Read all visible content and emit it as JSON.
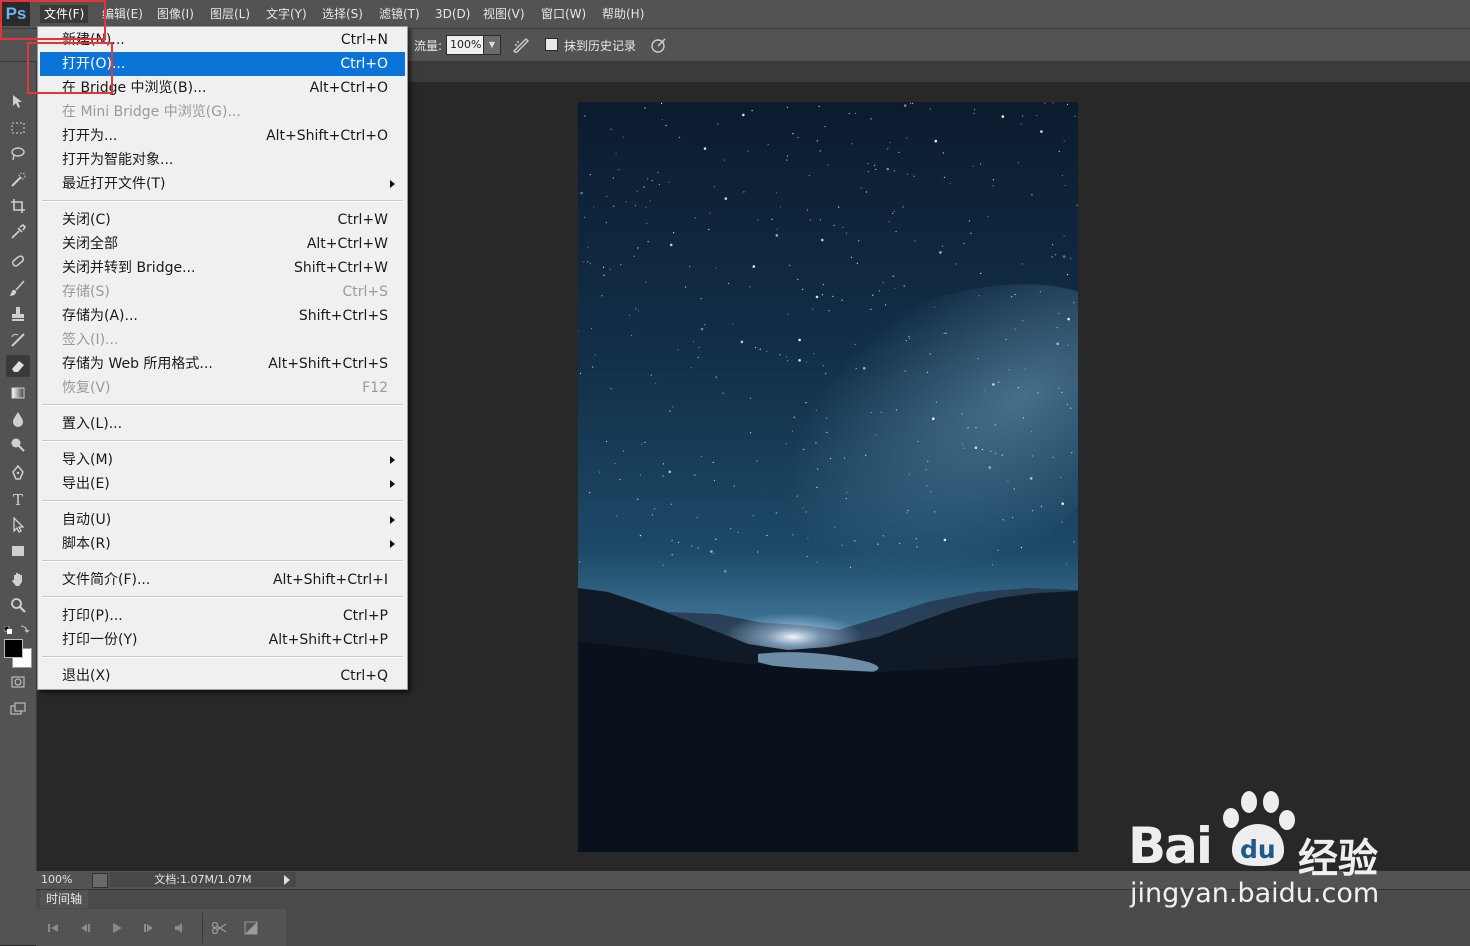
{
  "app": {
    "logo_text": "Ps"
  },
  "menubar": {
    "items": [
      "文件(F)",
      "编辑(E)",
      "图像(I)",
      "图层(L)",
      "文字(Y)",
      "选择(S)",
      "滤镜(T)",
      "3D(D)",
      "视图(V)",
      "窗口(W)",
      "帮助(H)"
    ]
  },
  "options": {
    "flow_label": "流量:",
    "flow_value": "100%",
    "erase_history_label": "抹到历史记录",
    "erase_history_checked": false
  },
  "file_menu": {
    "items": [
      {
        "label": "新建(N)...",
        "shortcut": "Ctrl+N"
      },
      {
        "label": "打开(O)...",
        "shortcut": "Ctrl+O"
      },
      {
        "label": "在 Bridge 中浏览(B)...",
        "shortcut": "Alt+Ctrl+O"
      },
      {
        "label": "在 Mini Bridge 中浏览(G)...",
        "shortcut": ""
      },
      {
        "label": "打开为...",
        "shortcut": "Alt+Shift+Ctrl+O"
      },
      {
        "label": "打开为智能对象...",
        "shortcut": ""
      },
      {
        "label": "最近打开文件(T)",
        "shortcut": ""
      },
      {
        "label": "关闭(C)",
        "shortcut": "Ctrl+W"
      },
      {
        "label": "关闭全部",
        "shortcut": "Alt+Ctrl+W"
      },
      {
        "label": "关闭并转到 Bridge...",
        "shortcut": "Shift+Ctrl+W"
      },
      {
        "label": "存储(S)",
        "shortcut": "Ctrl+S"
      },
      {
        "label": "存储为(A)...",
        "shortcut": "Shift+Ctrl+S"
      },
      {
        "label": "签入(I)...",
        "shortcut": ""
      },
      {
        "label": "存储为 Web 所用格式...",
        "shortcut": "Alt+Shift+Ctrl+S"
      },
      {
        "label": "恢复(V)",
        "shortcut": "F12"
      },
      {
        "label": "置入(L)...",
        "shortcut": ""
      },
      {
        "label": "导入(M)",
        "shortcut": ""
      },
      {
        "label": "导出(E)",
        "shortcut": ""
      },
      {
        "label": "自动(U)",
        "shortcut": ""
      },
      {
        "label": "脚本(R)",
        "shortcut": ""
      },
      {
        "label": "文件简介(F)...",
        "shortcut": "Alt+Shift+Ctrl+I"
      },
      {
        "label": "打印(P)...",
        "shortcut": "Ctrl+P"
      },
      {
        "label": "打印一份(Y)",
        "shortcut": "Alt+Shift+Ctrl+P"
      },
      {
        "label": "退出(X)",
        "shortcut": "Ctrl+Q"
      }
    ]
  },
  "status": {
    "zoom": "100%",
    "doc_info": "文档:1.07M/1.07M"
  },
  "timeline": {
    "tab_label": "时间轴"
  },
  "watermark": {
    "brand": "Bai",
    "brand_suffix": "经验",
    "paw_text": "du",
    "url": "jingyan.baidu.com"
  },
  "colors": {
    "menu_highlight": "#0a74d8",
    "annotation_red": "#e0363a",
    "ui_panel": "#535353",
    "workspace": "#282828"
  }
}
